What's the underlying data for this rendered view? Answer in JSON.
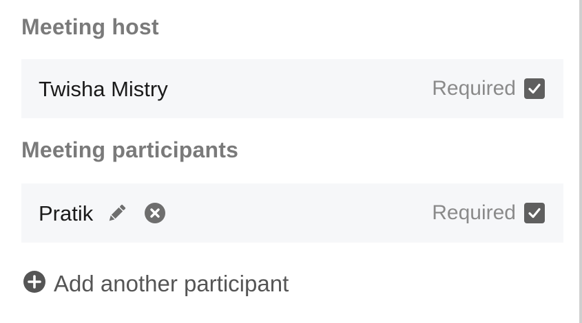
{
  "host_section": {
    "heading": "Meeting host",
    "host": {
      "name": "Twisha Mistry",
      "required_label": "Required",
      "required_checked": true
    }
  },
  "participants_section": {
    "heading": "Meeting participants",
    "participants": [
      {
        "name": "Pratik",
        "required_label": "Required",
        "required_checked": true,
        "icons": [
          "pencil-icon",
          "remove-circle-icon"
        ]
      }
    ]
  },
  "add_participant": {
    "label": "Add another participant",
    "icon": "plus-circle-icon"
  },
  "colors": {
    "heading": "#7a7a7a",
    "row_background": "#f6f7f9",
    "checkbox": "#5f5f5f",
    "muted_text": "#8a8a8a"
  }
}
